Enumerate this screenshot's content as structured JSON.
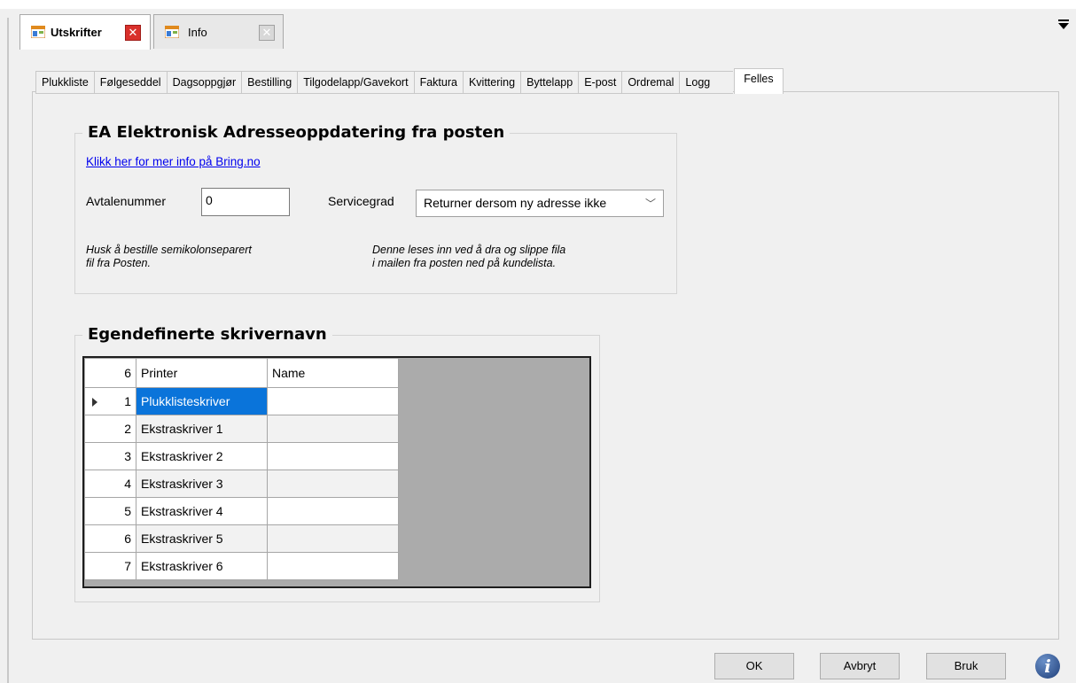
{
  "doc_tabs": [
    {
      "label": "Utskrifter",
      "icon": "app-window-icon",
      "active": true
    },
    {
      "label": "Info",
      "icon": "app-window-icon",
      "active": false
    }
  ],
  "tabs": [
    "Plukkliste",
    "Følgeseddel",
    "Dagsoppgjør",
    "Bestilling",
    "Tilgodelapp/Gavekort",
    "Faktura",
    "Kvittering",
    "Byttelapp",
    "E-post",
    "Ordremal",
    "Logg",
    "Felles"
  ],
  "active_tab": "Felles",
  "ea_group": {
    "title": "EA Elektronisk Adresseoppdatering fra posten",
    "link": "Klikk her for mer info på Bring.no",
    "avtalenummer_label": "Avtalenummer",
    "avtalenummer_value": "0",
    "servicegrad_label": "Servicegrad",
    "servicegrad_value": "Returner dersom ny adresse ikke",
    "hint_left_1": "Husk å bestille semikolonseparert",
    "hint_left_2": "fil fra Posten.",
    "hint_right_1": "Denne leses inn ved å dra og slippe fila",
    "hint_right_2": "i mailen fra posten ned på kundelista."
  },
  "printer_group": {
    "title": "Egendefinerte skrivernavn",
    "row_count": "6",
    "columns": [
      "Printer",
      "Name"
    ],
    "rows": [
      {
        "num": "1",
        "printer": "Plukklisteskriver",
        "name": ""
      },
      {
        "num": "2",
        "printer": "Ekstraskriver 1",
        "name": ""
      },
      {
        "num": "3",
        "printer": "Ekstraskriver 2",
        "name": ""
      },
      {
        "num": "4",
        "printer": "Ekstraskriver 3",
        "name": ""
      },
      {
        "num": "5",
        "printer": "Ekstraskriver 4",
        "name": ""
      },
      {
        "num": "6",
        "printer": "Ekstraskriver 5",
        "name": ""
      },
      {
        "num": "7",
        "printer": "Ekstraskriver 6",
        "name": ""
      }
    ]
  },
  "buttons": {
    "ok": "OK",
    "cancel": "Avbryt",
    "apply": "Bruk"
  },
  "colors": {
    "selection": "#0a74da",
    "link": "#0000ee",
    "close_red": "#d9302b"
  }
}
